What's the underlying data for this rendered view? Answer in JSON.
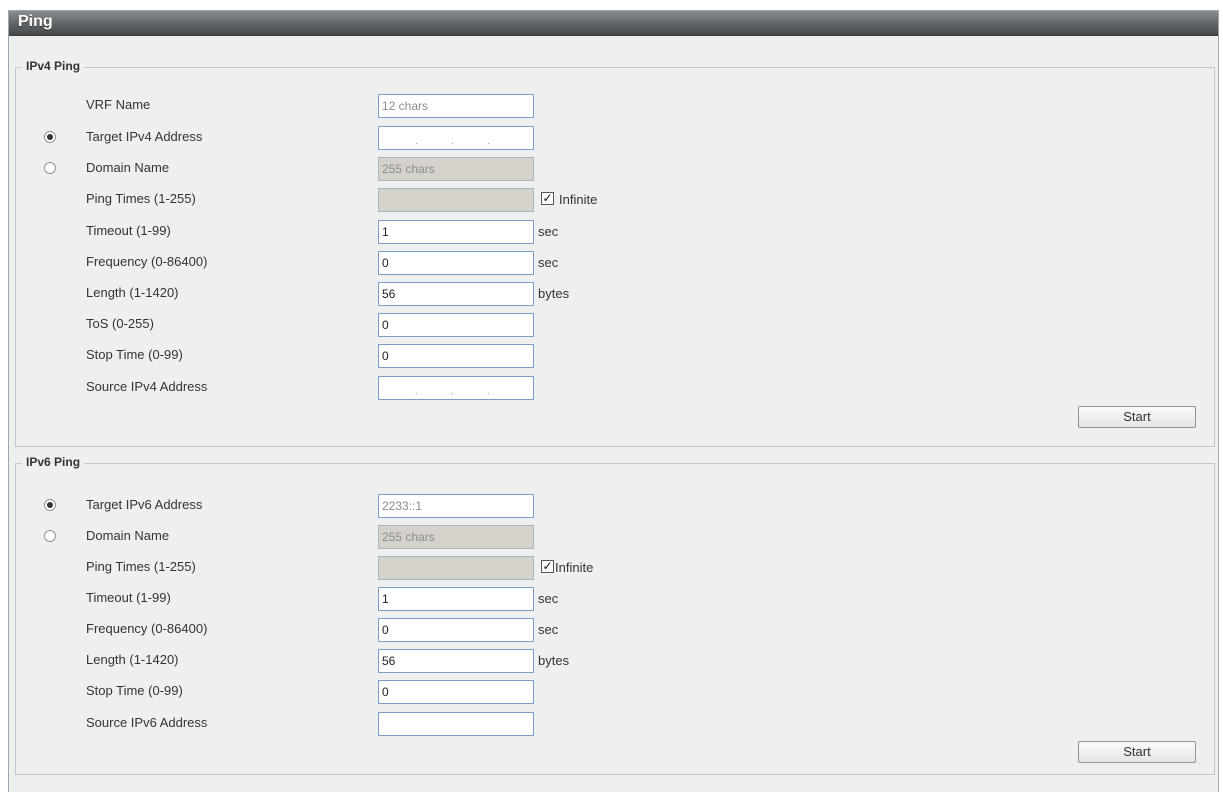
{
  "title": "Ping",
  "ipv4": {
    "legend": "IPv4 Ping",
    "vrf_label": "VRF Name",
    "vrf_placeholder": "12 chars",
    "target_label": "Target IPv4 Address",
    "target_selected": true,
    "domain_label": "Domain Name",
    "domain_placeholder": "255 chars",
    "ping_times_label": "Ping Times (1-255)",
    "infinite_label": "Infinite",
    "infinite_checked": true,
    "timeout_label": "Timeout (1-99)",
    "timeout_value": "1",
    "timeout_unit": "sec",
    "frequency_label": "Frequency (0-86400)",
    "frequency_value": "0",
    "frequency_unit": "sec",
    "length_label": "Length (1-1420)",
    "length_value": "56",
    "length_unit": "bytes",
    "tos_label": "ToS (0-255)",
    "tos_value": "0",
    "stop_time_label": "Stop Time (0-99)",
    "stop_time_value": "0",
    "source_label": "Source IPv4 Address",
    "start_label": "Start"
  },
  "ipv6": {
    "legend": "IPv6 Ping",
    "target_label": "Target IPv6 Address",
    "target_value": "2233::1",
    "target_selected": true,
    "domain_label": "Domain Name",
    "domain_placeholder": "255 chars",
    "ping_times_label": "Ping Times (1-255)",
    "infinite_label": "Infinite",
    "infinite_checked": true,
    "timeout_label": "Timeout (1-99)",
    "timeout_value": "1",
    "timeout_unit": "sec",
    "frequency_label": "Frequency (0-86400)",
    "frequency_value": "0",
    "frequency_unit": "sec",
    "length_label": "Length  (1-1420)",
    "length_value": "56",
    "length_unit": "bytes",
    "stop_time_label": "Stop Time (0-99)",
    "stop_time_value": "0",
    "source_label": "Source IPv6 Address",
    "source_value": "",
    "start_label": "Start"
  }
}
